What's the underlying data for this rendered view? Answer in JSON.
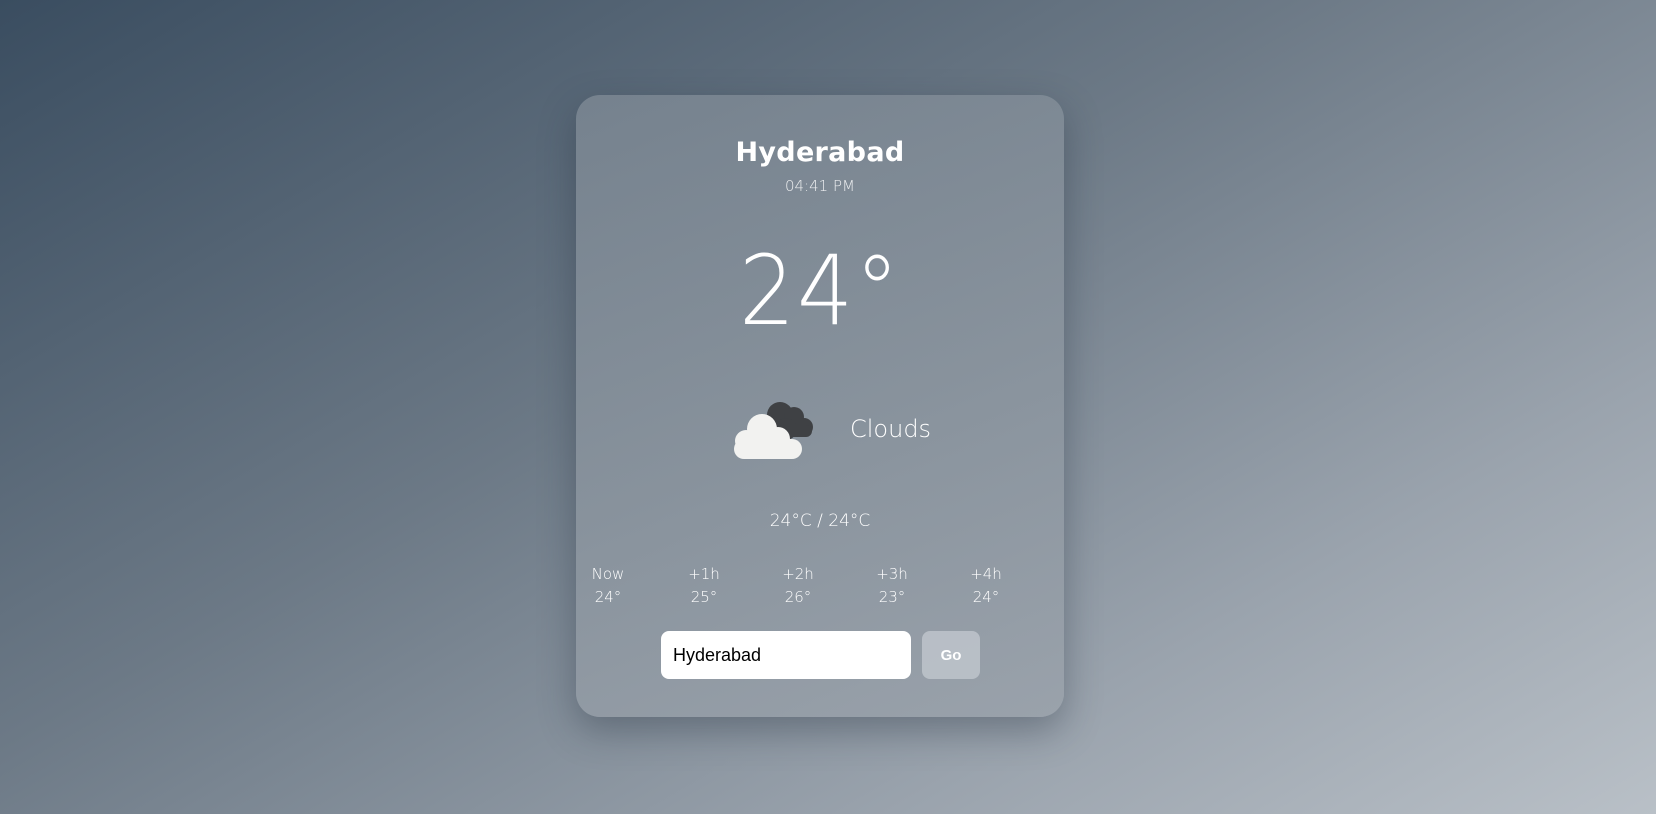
{
  "weather": {
    "city": "Hyderabad",
    "time": "04:41 PM",
    "temperature": "24°",
    "condition": "Clouds",
    "condition_icon": "cloud-icon",
    "range": "24°C / 24°C"
  },
  "hourly": [
    {
      "label": "Now",
      "temp": "24°"
    },
    {
      "label": "+1h",
      "temp": "25°"
    },
    {
      "label": "+2h",
      "temp": "26°"
    },
    {
      "label": "+3h",
      "temp": "23°"
    },
    {
      "label": "+4h",
      "temp": "24°"
    }
  ],
  "search": {
    "value": "Hyderabad",
    "button_label": "Go"
  }
}
